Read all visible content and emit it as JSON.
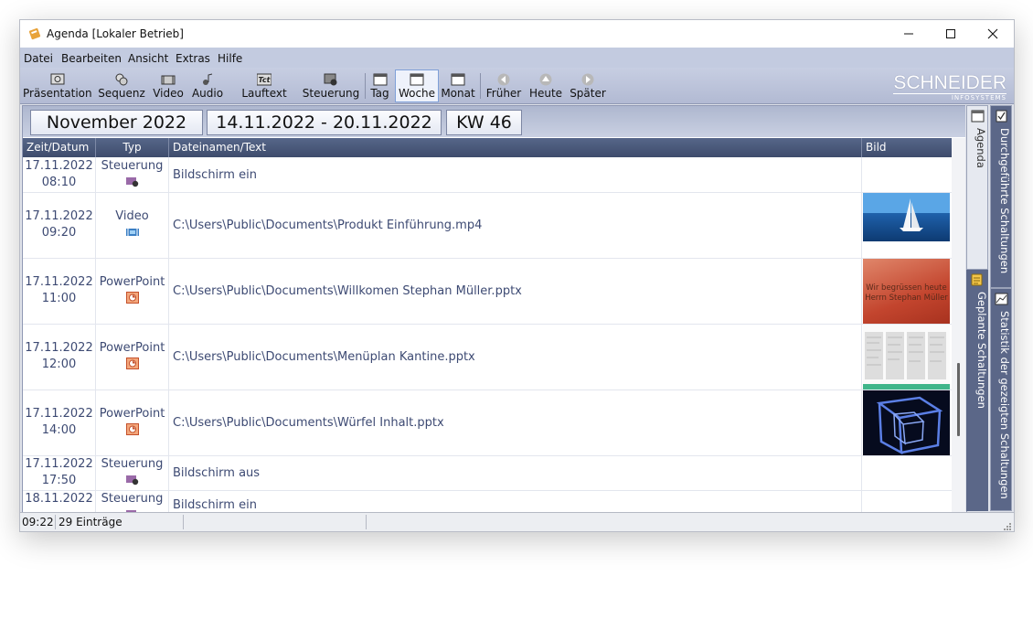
{
  "window": {
    "title": "Agenda [Lokaler Betrieb]"
  },
  "menu": [
    "Datei",
    "Bearbeiten",
    "Ansicht",
    "Extras",
    "Hilfe"
  ],
  "toolbar": {
    "items": [
      {
        "label": "Präsentation",
        "icon": "presentation-icon"
      },
      {
        "label": "Sequenz",
        "icon": "sequence-icon"
      },
      {
        "label": "Video",
        "icon": "video-icon"
      },
      {
        "label": "Audio",
        "icon": "audio-icon"
      },
      {
        "label": "Lauftext",
        "icon": "ticker-icon"
      },
      {
        "label": "Steuerung",
        "icon": "control-icon"
      },
      {
        "label": "Tag",
        "icon": "day-icon",
        "badge": "1"
      },
      {
        "label": "Woche",
        "icon": "week-icon",
        "badge": "7"
      },
      {
        "label": "Monat",
        "icon": "month-icon",
        "badge": "31"
      },
      {
        "label": "Früher",
        "icon": "arrow-left-icon"
      },
      {
        "label": "Heute",
        "icon": "arrow-up-icon"
      },
      {
        "label": "Später",
        "icon": "arrow-right-icon"
      }
    ],
    "active": "Woche"
  },
  "logo": {
    "name": "SCHNEIDER",
    "sub": "INFOSYSTEMS"
  },
  "period": {
    "month": "November 2022",
    "range": "14.11.2022 - 20.11.2022",
    "week": "KW 46"
  },
  "columns": [
    "Zeit/Datum",
    "Typ",
    "Dateinamen/Text",
    "Bild"
  ],
  "rows": [
    {
      "date": "17.11.2022",
      "time": "08:10",
      "type": "Steuerung",
      "icon": "control-icon",
      "text": "Bildschirm ein",
      "thumb": ""
    },
    {
      "date": "17.11.2022",
      "time": "09:20",
      "type": "Video",
      "icon": "video-icon",
      "text": "C:\\Users\\Public\\Documents\\Produkt Einführung.mp4",
      "thumb": "sailboat"
    },
    {
      "date": "17.11.2022",
      "time": "11:00",
      "type": "PowerPoint",
      "icon": "powerpoint-icon",
      "text": "C:\\Users\\Public\\Documents\\Willkomen Stephan Müller.pptx",
      "thumb": "welcome",
      "thumb_text": [
        "Wir begrüssen heute",
        "Herrn Stephan Müller"
      ]
    },
    {
      "date": "17.11.2022",
      "time": "12:00",
      "type": "PowerPoint",
      "icon": "powerpoint-icon",
      "text": "C:\\Users\\Public\\Documents\\Menüplan Kantine.pptx",
      "thumb": "menu"
    },
    {
      "date": "17.11.2022",
      "time": "14:00",
      "type": "PowerPoint",
      "icon": "powerpoint-icon",
      "text": "C:\\Users\\Public\\Documents\\Würfel Inhalt.pptx",
      "thumb": "cube"
    },
    {
      "date": "17.11.2022",
      "time": "17:50",
      "type": "Steuerung",
      "icon": "control-icon",
      "text": "Bildschirm aus",
      "thumb": ""
    },
    {
      "date": "18.11.2022",
      "time": "",
      "type": "Steuerung",
      "icon": "control-icon",
      "text": "Bildschirm ein",
      "thumb": ""
    }
  ],
  "sidetabs": {
    "left": [
      "Agenda",
      "Geplante Schaltungen"
    ],
    "right": [
      "Durchgeführte Schaltungen",
      "Statistik der gezeigten Schaltungen"
    ]
  },
  "status": {
    "time": "09:22",
    "entries": "29 Einträge"
  },
  "colors": {
    "header": "#4a5a7c",
    "menubar": "#c3cbe0",
    "accent": "#7fa0d8"
  }
}
